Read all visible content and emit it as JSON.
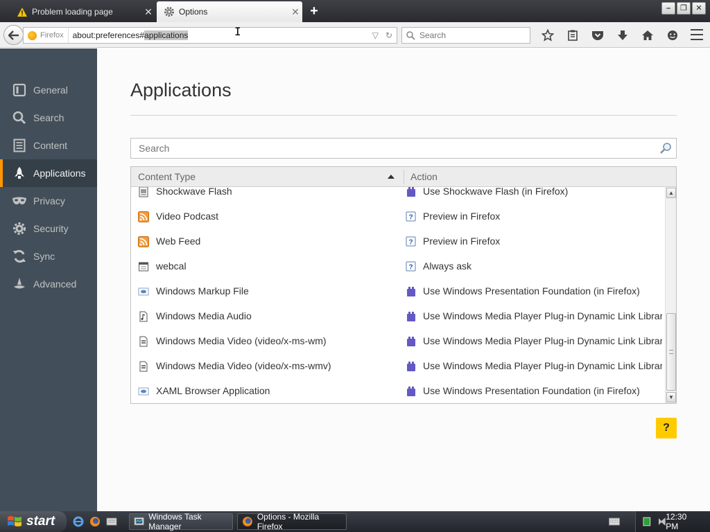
{
  "browser": {
    "tabs": [
      {
        "title": "Problem loading page",
        "icon": "warning-icon",
        "active": false
      },
      {
        "title": "Options",
        "icon": "gear-icon",
        "active": true
      }
    ],
    "identity_label": "Firefox",
    "url_prefix": "about:preferences#",
    "url_selected": "applications",
    "search_placeholder": "Search",
    "toolbar_icons": [
      "bookmark-star-icon",
      "reading-list-icon",
      "pocket-icon",
      "download-icon",
      "home-icon",
      "chat-icon"
    ]
  },
  "sidebar": {
    "items": [
      {
        "label": "General",
        "icon": "general-icon",
        "selected": false
      },
      {
        "label": "Search",
        "icon": "search-icon",
        "selected": false
      },
      {
        "label": "Content",
        "icon": "content-icon",
        "selected": false
      },
      {
        "label": "Applications",
        "icon": "applications-icon",
        "selected": true
      },
      {
        "label": "Privacy",
        "icon": "privacy-mask-icon",
        "selected": false
      },
      {
        "label": "Security",
        "icon": "security-padlock-icon",
        "selected": false
      },
      {
        "label": "Sync",
        "icon": "sync-icon",
        "selected": false
      },
      {
        "label": "Advanced",
        "icon": "advanced-wizard-icon",
        "selected": false
      }
    ],
    "accent": "#ff9500",
    "bg": "#424f5a"
  },
  "main": {
    "title": "Applications",
    "filter_placeholder": "Search",
    "columns": {
      "type": "Content Type",
      "action": "Action"
    },
    "rows": [
      {
        "type": "Shockwave Flash",
        "type_icon": "flash-file-icon",
        "action": "Use Shockwave Flash (in Firefox)",
        "action_icon": "plugin-icon"
      },
      {
        "type": "Video Podcast",
        "type_icon": "feed-icon",
        "action": "Preview in Firefox",
        "action_icon": "ask-icon"
      },
      {
        "type": "Web Feed",
        "type_icon": "feed-icon",
        "action": "Preview in Firefox",
        "action_icon": "ask-icon"
      },
      {
        "type": "webcal",
        "type_icon": "calendar-file-icon",
        "action": "Always ask",
        "action_icon": "ask-icon"
      },
      {
        "type": "Windows Markup File",
        "type_icon": "xaml-file-icon",
        "action": "Use Windows Presentation Foundation (in Firefox)",
        "action_icon": "plugin-icon"
      },
      {
        "type": "Windows Media Audio",
        "type_icon": "audio-file-icon",
        "action": "Use Windows Media Player Plug-in Dynamic Link Librar...",
        "action_icon": "plugin-icon"
      },
      {
        "type": "Windows Media Video (video/x-ms-wm)",
        "type_icon": "video-file-icon",
        "action": "Use Windows Media Player Plug-in Dynamic Link Librar...",
        "action_icon": "plugin-icon"
      },
      {
        "type": "Windows Media Video (video/x-ms-wmv)",
        "type_icon": "video-file-icon",
        "action": "Use Windows Media Player Plug-in Dynamic Link Librar...",
        "action_icon": "plugin-icon"
      },
      {
        "type": "XAML Browser Application",
        "type_icon": "xaml-file-icon",
        "action": "Use Windows Presentation Foundation (in Firefox)",
        "action_icon": "plugin-icon"
      }
    ],
    "help_label": "?"
  },
  "taskbar": {
    "start_label": "start",
    "tasks": [
      {
        "label": "Windows Task Manager",
        "icon": "task-manager-icon",
        "active": false
      },
      {
        "label": "Options - Mozilla Firefox",
        "icon": "firefox-icon",
        "active": true
      }
    ],
    "clock": "12:30 PM"
  }
}
